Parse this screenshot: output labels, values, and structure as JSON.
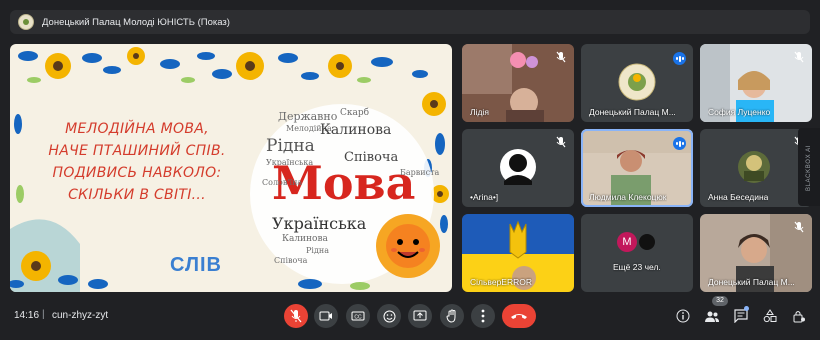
{
  "meeting": {
    "title": "Донецький Палац Молоді ЮНІСТЬ (Показ)",
    "time": "14:16",
    "separator": "|",
    "code": "cun-zhyz-zyt",
    "participants_count": "32"
  },
  "presentation": {
    "poem_lines": [
      "МЕЛОДІЙНА МОВА,",
      "НАЧЕ ПТАШИНИЙ СПІВ.",
      "ПОДИВИСЬ НАВКОЛО:",
      "СКІЛЬКИ В СВІТІ..."
    ],
    "brand": "СЛІВ",
    "main_word": "Мова",
    "cloud_words": [
      "Державно",
      "Скарб",
      "Мелодійна",
      "Калинова",
      "Рідна",
      "Співоча",
      "Українська",
      "Калинова",
      "Рідна",
      "Українська",
      "Мова",
      "Рідна",
      "Співоча",
      "Мелодійна",
      "Солов'їна",
      "Барвиста"
    ]
  },
  "participants": [
    {
      "name": "Лідія",
      "muted": true,
      "speaking": false
    },
    {
      "name": "Донецький Палац М...",
      "muted": false,
      "speaking": true
    },
    {
      "name": "София Луценко",
      "muted": true,
      "speaking": false
    },
    {
      "name": "•Arina•]",
      "muted": true,
      "speaking": false
    },
    {
      "name": "Людмила Клекоцюк",
      "muted": false,
      "speaking": true
    },
    {
      "name": "Анна Беседина",
      "muted": true,
      "speaking": false
    },
    {
      "name": "СільверERROR",
      "muted": false,
      "speaking": false
    },
    {
      "name": "Ещё 23 чел.",
      "muted": false,
      "speaking": false
    },
    {
      "name": "Донецький Палац М...",
      "muted": true,
      "speaking": false
    }
  ],
  "more_tile": {
    "avatar_letter": "М",
    "avatar_color": "#c2185b"
  },
  "side_panel": {
    "label": "BLACKBOX AI"
  },
  "colors": {
    "accent": "#8ab4f8",
    "danger": "#ea4335",
    "speaking": "#1a73e8"
  }
}
